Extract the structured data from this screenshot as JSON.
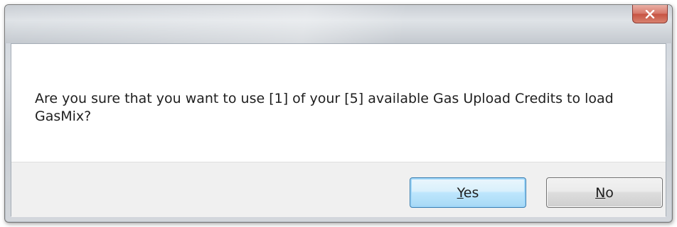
{
  "dialog": {
    "title": "",
    "message": "Are you sure that you want to use [1] of your [5] available Gas Upload Credits to load GasMix?",
    "close_icon": "close-icon",
    "buttons": {
      "yes_label": "Yes",
      "no_label": "No"
    }
  },
  "colors": {
    "close_button": "#c75342",
    "default_button_border": "#3c7fb1",
    "button_area": "#f0f0f0"
  }
}
